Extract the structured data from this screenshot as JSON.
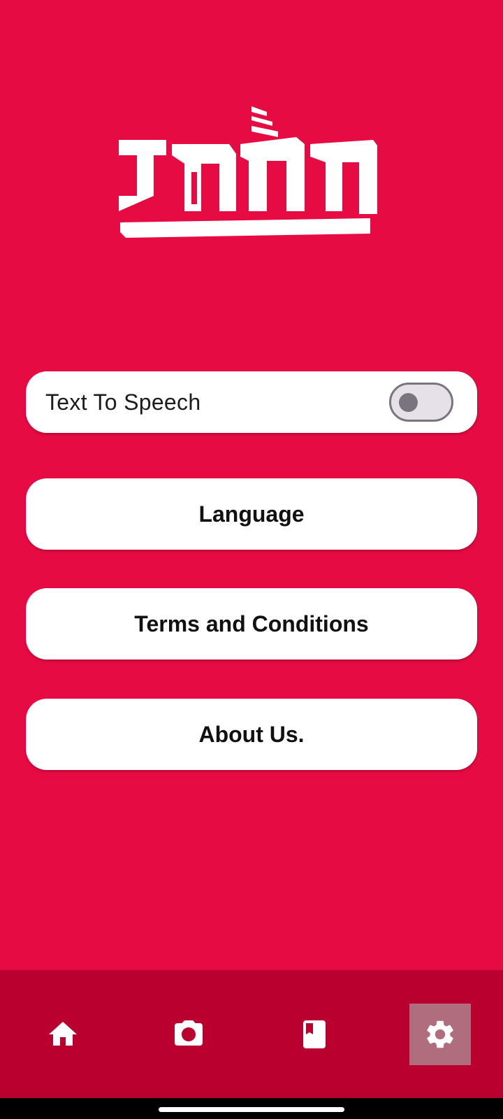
{
  "app": {
    "logo_name": "app-logo",
    "accent_color": "#E60B42",
    "nav_color": "#BA002F"
  },
  "settings": {
    "text_to_speech": {
      "label": "Text To Speech",
      "enabled": false
    },
    "buttons": [
      {
        "label": "Language"
      },
      {
        "label": "Terms and Conditions"
      },
      {
        "label": "About Us."
      }
    ]
  },
  "bottom_nav": {
    "items": [
      {
        "icon": "home-icon",
        "selected": false
      },
      {
        "icon": "camera-icon",
        "selected": false
      },
      {
        "icon": "book-icon",
        "selected": false
      },
      {
        "icon": "gear-icon",
        "selected": true
      }
    ]
  }
}
